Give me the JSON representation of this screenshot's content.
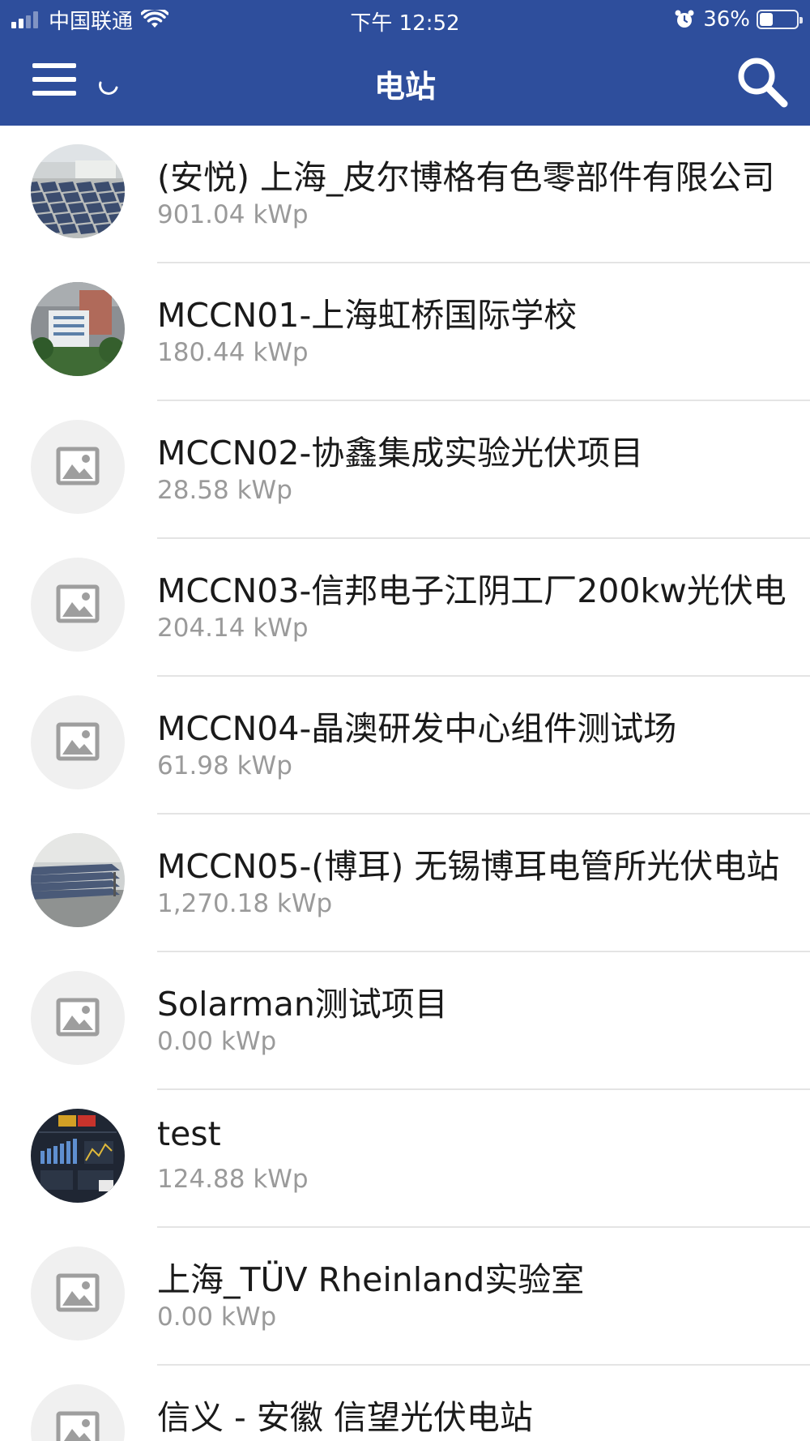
{
  "status_bar": {
    "carrier": "中国联通",
    "time": "下午 12:52",
    "battery": "36%",
    "battery_level": 0.36,
    "signal_bars": 2,
    "icons": [
      "signal-icon",
      "wifi-icon",
      "alarm-icon",
      "battery-icon"
    ]
  },
  "nav": {
    "title": "电站",
    "left_icon": "menu-icon",
    "loading_icon": "spinner-icon",
    "right_icon": "search-icon"
  },
  "colors": {
    "header": "#2e4e9c",
    "text": "#1a1a1a",
    "secondary_text": "#9a9a9a",
    "divider": "#e4e4e4",
    "placeholder_bg": "#f0f0f0",
    "placeholder_icon": "#9e9e9e"
  },
  "stations": [
    {
      "name": "(安悦) 上海_皮尔博格有色零部件有限公司",
      "capacity": "901.04 kWp",
      "image": "rooftop-solar-photo"
    },
    {
      "name": "MCCN01-上海虹桥国际学校",
      "capacity": "180.44 kWp",
      "image": "school-building-photo"
    },
    {
      "name": "MCCN02-协鑫集成实验光伏项目",
      "capacity": "28.58 kWp",
      "image": "placeholder-image-icon"
    },
    {
      "name": "MCCN03-信邦电子江阴工厂200kw光伏电",
      "capacity": "204.14 kWp",
      "image": "placeholder-image-icon"
    },
    {
      "name": "MCCN04-晶澳研发中心组件测试场",
      "capacity": "61.98 kWp",
      "image": "placeholder-image-icon"
    },
    {
      "name": "MCCN05-(博耳) 无锡博耳电管所光伏电站",
      "capacity": "1,270.18 kWp",
      "image": "solar-panels-photo"
    },
    {
      "name": "Solarman测试项目",
      "capacity": "0.00 kWp",
      "image": "placeholder-image-icon"
    },
    {
      "name": "test",
      "capacity": "124.88 kWp",
      "image": "dashboard-screenshot"
    },
    {
      "name": "上海_TÜV Rheinland实验室",
      "capacity": "0.00 kWp",
      "image": "placeholder-image-icon"
    },
    {
      "name": "信义 - 安徽 信望光伏电站",
      "capacity": "",
      "image": "placeholder-image-icon"
    }
  ]
}
